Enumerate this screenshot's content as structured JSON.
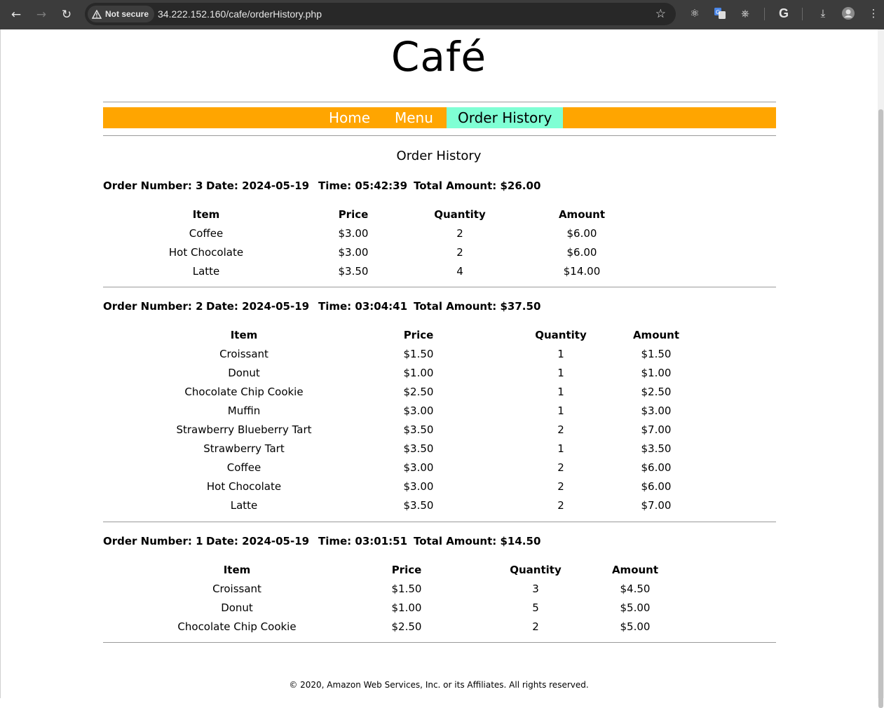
{
  "browser": {
    "security_label": "Not secure",
    "url": "34.222.152.160/cafe/orderHistory.php"
  },
  "site": {
    "title": "Café",
    "nav": [
      "Home",
      "Menu",
      "Order History"
    ],
    "heading": "Order History",
    "footer": "© 2020, Amazon Web Services, Inc. or its Affiliates. All rights reserved."
  },
  "colors": {
    "nav_bg": "#ffa500",
    "nav_active_bg": "#7fffd4"
  },
  "columns": [
    "Item",
    "Price",
    "Quantity",
    "Amount"
  ],
  "orders": [
    {
      "number": "Order Number: 3",
      "date": "Date: 2024-05-19",
      "time": "Time: 05:42:39",
      "total": "Total Amount: $26.00",
      "rows": [
        [
          "Coffee",
          "$3.00",
          "2",
          "$6.00"
        ],
        [
          "Hot Chocolate",
          "$3.00",
          "2",
          "$6.00"
        ],
        [
          "Latte",
          "$3.50",
          "4",
          "$14.00"
        ]
      ]
    },
    {
      "number": "Order Number: 2",
      "date": "Date: 2024-05-19",
      "time": "Time: 03:04:41",
      "total": "Total Amount: $37.50",
      "rows": [
        [
          "Croissant",
          "$1.50",
          "1",
          "$1.50"
        ],
        [
          "Donut",
          "$1.00",
          "1",
          "$1.00"
        ],
        [
          "Chocolate Chip Cookie",
          "$2.50",
          "1",
          "$2.50"
        ],
        [
          "Muffin",
          "$3.00",
          "1",
          "$3.00"
        ],
        [
          "Strawberry Blueberry Tart",
          "$3.50",
          "2",
          "$7.00"
        ],
        [
          "Strawberry Tart",
          "$3.50",
          "1",
          "$3.50"
        ],
        [
          "Coffee",
          "$3.00",
          "2",
          "$6.00"
        ],
        [
          "Hot Chocolate",
          "$3.00",
          "2",
          "$6.00"
        ],
        [
          "Latte",
          "$3.50",
          "2",
          "$7.00"
        ]
      ]
    },
    {
      "number": "Order Number: 1",
      "date": "Date: 2024-05-19",
      "time": "Time: 03:01:51",
      "total": "Total Amount: $14.50",
      "rows": [
        [
          "Croissant",
          "$1.50",
          "3",
          "$4.50"
        ],
        [
          "Donut",
          "$1.00",
          "5",
          "$5.00"
        ],
        [
          "Chocolate Chip Cookie",
          "$2.50",
          "2",
          "$5.00"
        ]
      ]
    }
  ]
}
